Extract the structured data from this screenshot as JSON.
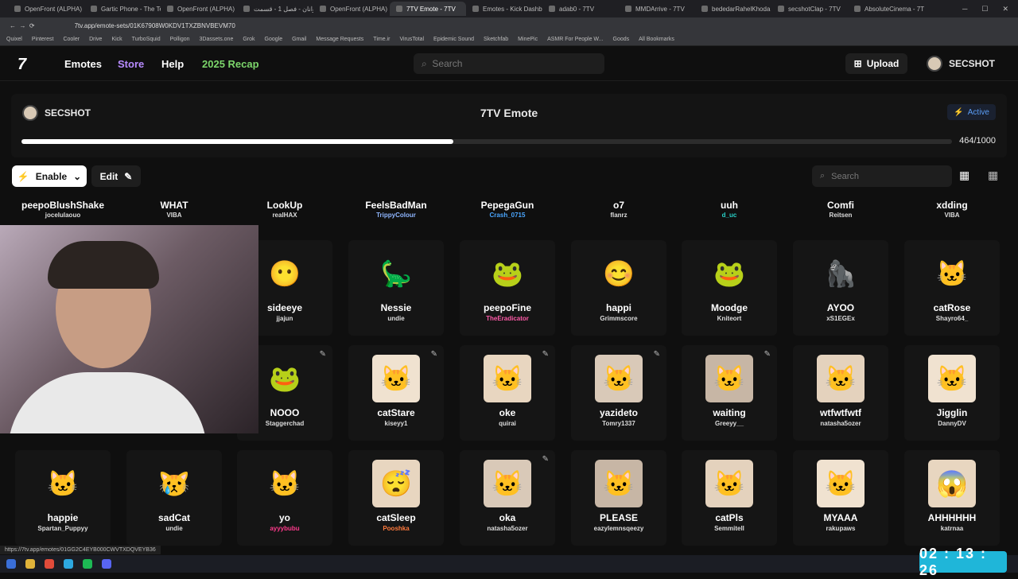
{
  "browser": {
    "tabs": [
      "OpenFront (ALPHA)",
      "Gartic Phone - The Tel",
      "OpenFront (ALPHA)",
      "پهلوانان - فصل 1 - قسمت",
      "OpenFront (ALPHA)",
      "7TV Emote - 7TV",
      "Emotes - Kick Dashbo",
      "adab0 - 7TV",
      "MMDArrive - 7TV",
      "bededarRahelKhoda -",
      "secshotClap - 7TV",
      "AbsoluteCinema - 7TV"
    ],
    "url": "7tv.app/emote-sets/01K67908W0KDV1TXZBNVBEVM70",
    "bookmarks": [
      "Quixel",
      "Pinterest",
      "Cooler",
      "Drive",
      "Kick",
      "TurboSquid",
      "Polligon",
      "3Dassets.one",
      "Grok",
      "Google",
      "Gmail",
      "Message Requests",
      "Time.ir",
      "VirusTotal",
      "Epidemic Sound",
      "Sketchfab",
      "MinePic",
      "ASMR For People W...",
      "Goods",
      "All Bookmarks"
    ],
    "status_url": "https://7tv.app/emotes/01GG2C4EYB000CWVTXDQVEYB36"
  },
  "nav": {
    "logo": "7",
    "links": [
      "Emotes",
      "Store",
      "Help",
      "2025 Recap"
    ],
    "search_placeholder": "Search",
    "upload": "Upload",
    "user": "SECSHOT"
  },
  "set": {
    "owner": "SECSHOT",
    "title": "7TV Emote",
    "status": "Active",
    "capacity_used": 464,
    "capacity_max": 1000,
    "capacity_text": "464/1000"
  },
  "toolbar": {
    "enable": "Enable",
    "edit": "Edit",
    "search_placeholder": "Search"
  },
  "emote_rows": [
    [
      {
        "name": "peepoBlushShake",
        "author": "jocelulaouo"
      },
      {
        "name": "WHAT",
        "author": "VIBA"
      },
      {
        "name": "LookUp",
        "author": "realHAX"
      },
      {
        "name": "FeelsBadMan",
        "author": "TrippyColour"
      },
      {
        "name": "PepegaGun",
        "author": "Crash_0715"
      },
      {
        "name": "o7",
        "author": "flanrz"
      },
      {
        "name": "uuh",
        "author": "d_uc"
      },
      {
        "name": "Comfi",
        "author": "Reitsen"
      },
      {
        "name": "xdding",
        "author": "VIBA"
      }
    ],
    [
      {
        "name": "",
        "author": "",
        "emoji": ""
      },
      {
        "name": "",
        "author": "",
        "emoji": ""
      },
      {
        "name": "sideeye",
        "author": "jjajun",
        "emoji": "😶"
      },
      {
        "name": "Nessie",
        "author": "undie",
        "emoji": "🦕"
      },
      {
        "name": "peepoFine",
        "author": "TheEradicator",
        "emoji": "🐸"
      },
      {
        "name": "happi",
        "author": "Grimmscore",
        "emoji": "😊"
      },
      {
        "name": "Moodge",
        "author": "Kniteort",
        "emoji": "🐸"
      },
      {
        "name": "AYOO",
        "author": "xS1EGEx",
        "emoji": "🦍"
      },
      {
        "name": "catRose",
        "author": "Shayro64_",
        "emoji": "🐱"
      }
    ],
    [
      {
        "name": "",
        "author": "",
        "emoji": ""
      },
      {
        "name": "",
        "author": "",
        "emoji": ""
      },
      {
        "name": "NOOO",
        "author": "Staggerchad",
        "emoji": "🐸"
      },
      {
        "name": "catStare",
        "author": "kiseyy1",
        "emoji": "🐱"
      },
      {
        "name": "oke",
        "author": "quirai",
        "emoji": "🐱"
      },
      {
        "name": "yazideto",
        "author": "Tomry1337",
        "emoji": "🐱"
      },
      {
        "name": "waiting",
        "author": "Greeyy__",
        "emoji": "🐱"
      },
      {
        "name": "wtfwtfwtf",
        "author": "natasha5ozer",
        "emoji": "🐱"
      },
      {
        "name": "Jigglin",
        "author": "DannyDV",
        "emoji": "🐱"
      }
    ],
    [
      {
        "name": "happie",
        "author": "Spartan_Puppyy",
        "emoji": "🐱"
      },
      {
        "name": "sadCat",
        "author": "undie",
        "emoji": "😿"
      },
      {
        "name": "yo",
        "author": "ayyybubu",
        "emoji": "🐱"
      },
      {
        "name": "catSleep",
        "author": "Pooshka",
        "emoji": "😴"
      },
      {
        "name": "oka",
        "author": "natasha5ozer",
        "emoji": "🐱"
      },
      {
        "name": "PLEASE",
        "author": "eazylemnsqeezy",
        "emoji": "🐱"
      },
      {
        "name": "catPls",
        "author": "Semmitell",
        "emoji": "🐱"
      },
      {
        "name": "MYAAA",
        "author": "rakupaws",
        "emoji": "🐱"
      },
      {
        "name": "AHHHHHH",
        "author": "katrnaa",
        "emoji": "😱"
      }
    ]
  ],
  "author_colors": {
    "TrippyColour": "#8fb6ff",
    "Crash_0715": "#4aa6ff",
    "d_uc": "#28d1c7",
    "TheEradicator": "#ff5aa8",
    "Pooshka": "#ff7a3d",
    "ayyybubu": "#ff3a8c"
  },
  "timer": "02 : 13 : 26"
}
